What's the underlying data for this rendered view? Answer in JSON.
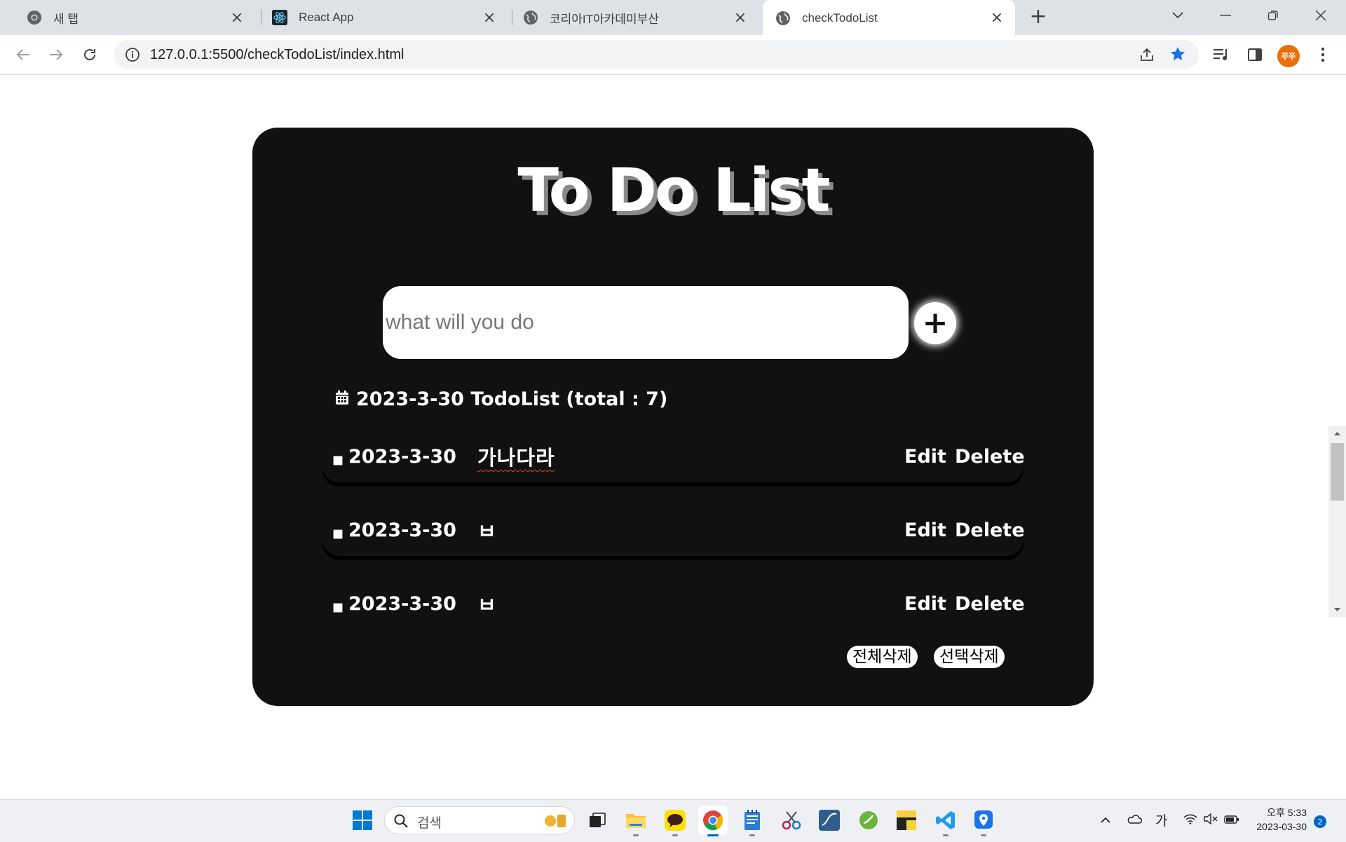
{
  "browser": {
    "tabs": [
      {
        "label": "새 탭",
        "icon": "chrome-icon"
      },
      {
        "label": "React App",
        "icon": "react-icon"
      },
      {
        "label": "코리아IT아카데미부산",
        "icon": "globe-icon"
      },
      {
        "label": "checkTodoList",
        "icon": "globe-icon",
        "active": true
      }
    ],
    "url": "127.0.0.1:5500/checkTodoList/index.html",
    "profile_initials": "쭈쭈"
  },
  "app": {
    "title": "To Do List",
    "input_placeholder": "what will you do",
    "add_label": "+",
    "list_header": "2023-3-30 TodoList (total : 7)",
    "todos": [
      {
        "date": "2023-3-30",
        "text": "가나다라",
        "edit": "Edit",
        "delete": "Delete"
      },
      {
        "date": "2023-3-30",
        "text": "ㅂ",
        "edit": "Edit",
        "delete": "Delete"
      },
      {
        "date": "2023-3-30",
        "text": "ㅂ",
        "edit": "Edit",
        "delete": "Delete"
      }
    ],
    "delete_all_label": "전체삭제",
    "delete_selected_label": "선택삭제"
  },
  "taskbar": {
    "search_label": "검색",
    "ime_label": "가",
    "time": "오후 5:33",
    "date": "2023-03-30",
    "notification_count": "2"
  },
  "colors": {
    "card_bg": "#111111",
    "accent": "#1a73e8",
    "taskbar_bg": "#eef0f3"
  }
}
